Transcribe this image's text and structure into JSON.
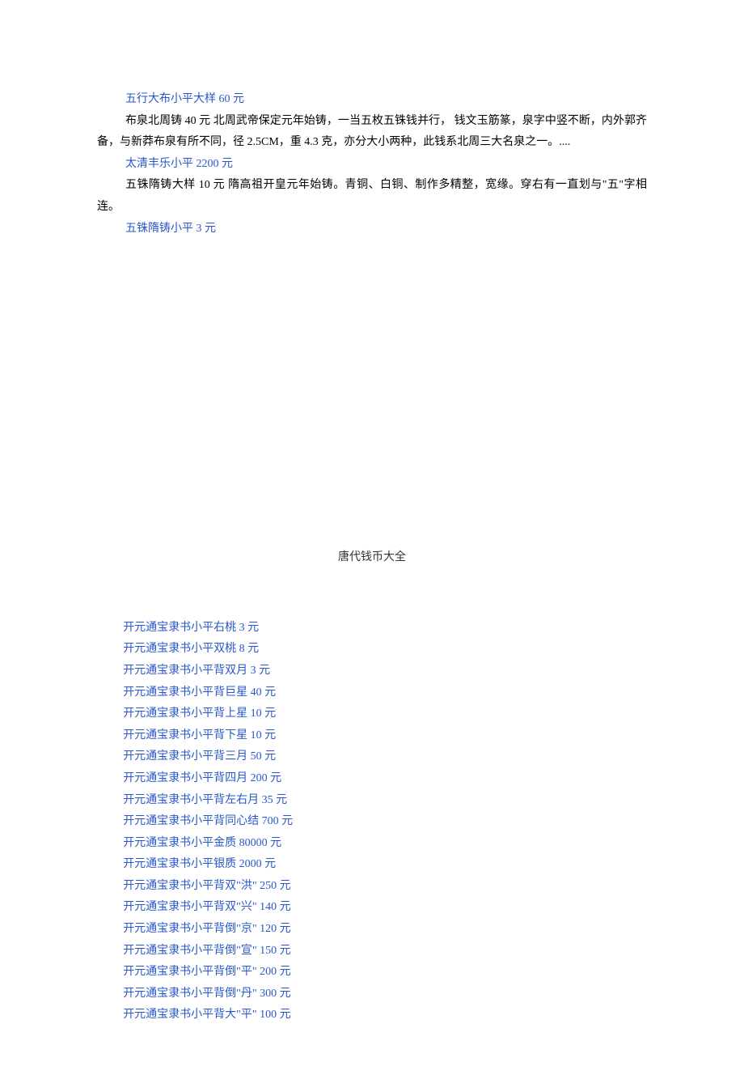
{
  "top": {
    "line1": "五行大布小平大样 60 元",
    "desc1": "布泉北周铸 40 元 北周武帝保定元年始铸，一当五枚五铢钱并行， 钱文玉筋篆，泉字中竖不断，内外郭齐备，与新莽布泉有所不同，径 2.5CM，重 4.3 克，亦分大小两种，此钱系北周三大名泉之一。....",
    "line2": "太清丰乐小平 2200 元",
    "desc2": "五铢隋铸大样 10 元 隋高祖开皇元年始铸。青铜、白铜、制作多精整，宽缘。穿右有一直划与\"五\"字相连。",
    "line3": "五铢隋铸小平 3 元"
  },
  "sectionTitle": "唐代钱币大全",
  "items": [
    "开元通宝隶书小平右桃 3 元",
    "开元通宝隶书小平双桃 8 元",
    "开元通宝隶书小平背双月 3 元",
    "开元通宝隶书小平背巨星 40 元",
    "开元通宝隶书小平背上星 10 元",
    "开元通宝隶书小平背下星 10 元",
    "开元通宝隶书小平背三月 50 元",
    "开元通宝隶书小平背四月 200 元",
    "开元通宝隶书小平背左右月 35 元",
    "开元通宝隶书小平背同心结 700 元",
    "开元通宝隶书小平金质 80000 元",
    "开元通宝隶书小平银质 2000 元",
    "开元通宝隶书小平背双\"洪\" 250 元",
    "开元通宝隶书小平背双\"兴\" 140 元",
    "开元通宝隶书小平背倒\"京\" 120 元",
    "开元通宝隶书小平背倒\"宣\" 150 元",
    "开元通宝隶书小平背倒\"平\" 200 元",
    "开元通宝隶书小平背倒\"丹\" 300 元",
    "开元通宝隶书小平背大\"平\" 100 元"
  ]
}
